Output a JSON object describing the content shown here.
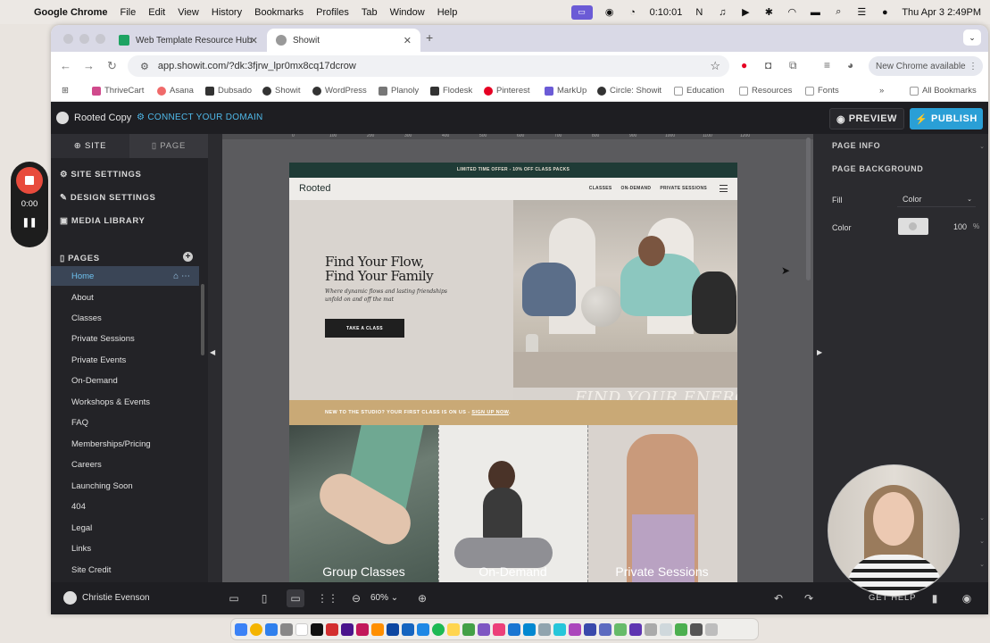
{
  "menubar": {
    "app": "Google Chrome",
    "items": [
      "File",
      "Edit",
      "View",
      "History",
      "Bookmarks",
      "Profiles",
      "Tab",
      "Window",
      "Help"
    ],
    "timer": "0:10:01",
    "datetime": "Thu Apr 3  2:49PM"
  },
  "browser": {
    "tabs": [
      {
        "title": "Web Template Resource Hub",
        "favicon_color": "#1ea362"
      },
      {
        "title": "Showit",
        "favicon_color": "#888888"
      }
    ],
    "url": "app.showit.com/?dk:3fjrw_lpr0mx8cq17dcrow",
    "new_chrome": "New Chrome available",
    "bookmarks": [
      {
        "label": "ThriveCart",
        "color": "#d04a8c"
      },
      {
        "label": "Asana",
        "color": "#f06a6a"
      },
      {
        "label": "Dubsado",
        "color": "#333333"
      },
      {
        "label": "Showit",
        "color": "#333333"
      },
      {
        "label": "WordPress",
        "color": "#333333"
      },
      {
        "label": "Planoly",
        "color": "#777777"
      },
      {
        "label": "Flodesk",
        "color": "#333333"
      },
      {
        "label": "Pinterest",
        "color": "#e60023"
      },
      {
        "label": "MarkUp",
        "color": "#6b5bd6"
      },
      {
        "label": "Circle: Showit",
        "color": "#333333"
      },
      {
        "label": "Education",
        "color": "#999999"
      },
      {
        "label": "Resources",
        "color": "#999999"
      },
      {
        "label": "Fonts",
        "color": "#999999"
      }
    ],
    "all_bookmarks": "All Bookmarks"
  },
  "showit": {
    "site_name": "Rooted Copy",
    "connect_domain": "CONNECT YOUR DOMAIN",
    "preview": "PREVIEW",
    "publish": "PUBLISH",
    "left_tabs": {
      "site": "SITE",
      "page": "PAGE"
    },
    "settings": [
      "SITE SETTINGS",
      "DESIGN SETTINGS",
      "MEDIA LIBRARY"
    ],
    "pages_header": "PAGES",
    "pages": [
      "Home",
      "About",
      "Classes",
      "Private Sessions",
      "Private Events",
      "On-Demand",
      "Workshops & Events",
      "FAQ",
      "Memberships/Pricing",
      "Careers",
      "Launching Soon",
      "404",
      "Legal",
      "Links",
      "Site Credit"
    ],
    "active_page": "Home",
    "right_panel": {
      "page_info": "PAGE INFO",
      "page_background": "PAGE BACKGROUND",
      "fill_label": "Fill",
      "fill_value": "Color",
      "color_label": "Color",
      "opacity": "100",
      "opacity_unit": "%"
    },
    "user": "Christie Evenson",
    "zoom": "60%",
    "get_help": "GET HELP",
    "ruler_ticks": [
      "0",
      "100",
      "200",
      "300",
      "400",
      "500",
      "600",
      "700",
      "800",
      "900",
      "1000",
      "1100",
      "1200"
    ]
  },
  "site_preview": {
    "promo": "LIMITED TIME OFFER - 10% OFF CLASS PACKS",
    "brand": "Rooted",
    "nav": [
      "CLASSES",
      "ON-DEMAND",
      "PRIVATE SESSIONS"
    ],
    "hero_title_1": "Find Your Flow,",
    "hero_title_2": "Find Your Family",
    "hero_sub": "Where dynamic flows and lasting friendships unfold on and off the mat",
    "hero_button": "TAKE A CLASS",
    "energy": "FIND YOUR ENERGY",
    "new_bar": "NEW TO THE STUDIO? YOUR FIRST CLASS IS ON US -",
    "new_bar_link": "SIGN UP NOW",
    "new_bar_end": ".",
    "cards": [
      "Group Classes",
      "On-Demand",
      "Private Sessions"
    ]
  },
  "recorder": {
    "time": "0:00"
  },
  "colors": {
    "accent": "#2a9fd6",
    "active_page": "#6ec1ee",
    "gold": "#c9a976",
    "promo": "#1f3b36",
    "record": "#e84b3c"
  }
}
